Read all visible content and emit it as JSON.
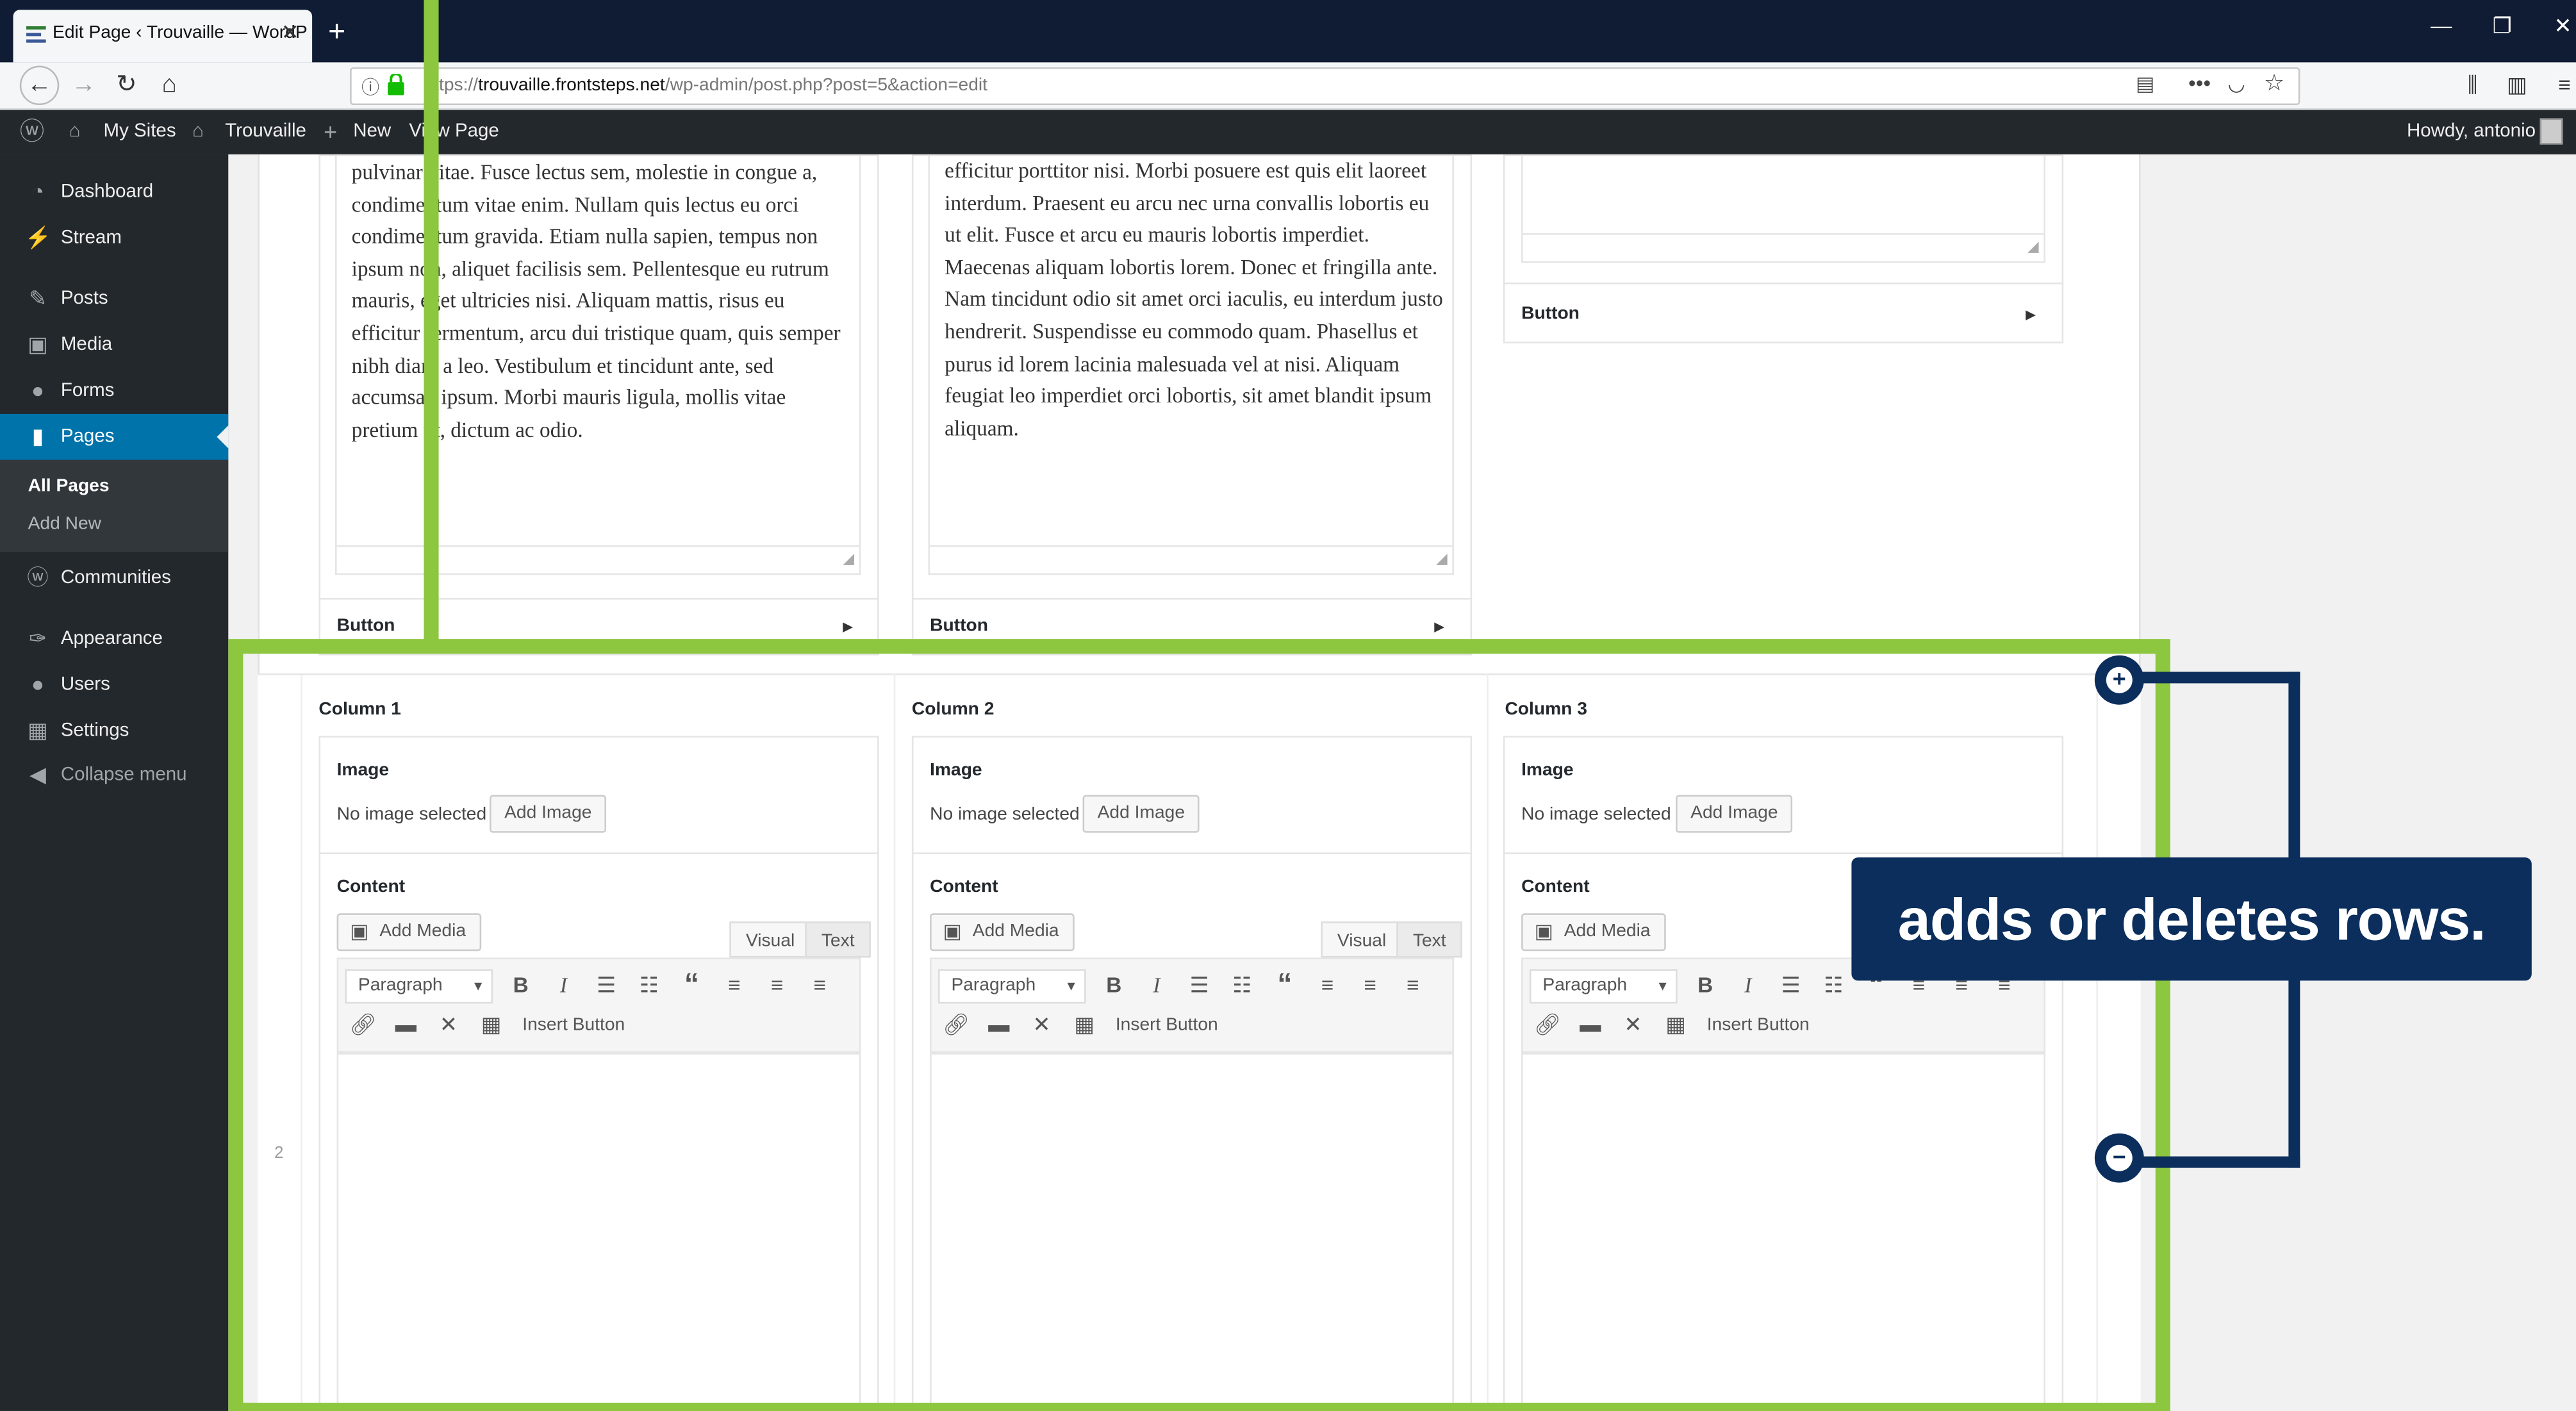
{
  "browser": {
    "tab_title": "Edit Page ‹ Trouvaille — WordP",
    "url_prefix": "https://",
    "url_domain": "trouvaille.frontsteps.net",
    "url_path": "/wp-admin/post.php?post=5&action=edit"
  },
  "adminbar": {
    "my_sites": "My Sites",
    "site_name": "Trouvaille",
    "new": "New",
    "view_page": "View Page",
    "howdy": "Howdy, antonio"
  },
  "sidebar": {
    "items": [
      {
        "label": "Dashboard",
        "icon": "dashboard-icon"
      },
      {
        "label": "Stream",
        "icon": "stream-icon"
      },
      {
        "label": "Posts",
        "icon": "pin-icon"
      },
      {
        "label": "Media",
        "icon": "media-icon"
      },
      {
        "label": "Forms",
        "icon": "forms-icon"
      },
      {
        "label": "Pages",
        "icon": "pages-icon"
      },
      {
        "label": "Communities",
        "icon": "communities-icon"
      },
      {
        "label": "Appearance",
        "icon": "brush-icon"
      },
      {
        "label": "Users",
        "icon": "user-icon"
      },
      {
        "label": "Settings",
        "icon": "settings-icon"
      },
      {
        "label": "Collapse menu",
        "icon": "collapse-icon"
      }
    ],
    "submenu": [
      "All Pages",
      "Add New"
    ]
  },
  "row1": {
    "col1_text": "pulvinar vitae. Fusce lectus sem, molestie in congue a, condimentum vitae enim. Nullam quis lectus eu orci condimentum gravida. Etiam nulla sapien, tempus non ipsum non, aliquet facilisis sem. Pellentesque eu rutrum mauris, eget ultricies nisi. Aliquam mattis, risus eu efficitur fermentum, arcu dui tristique quam, quis semper nibh diam a leo. Vestibulum et tincidunt ante, sed accumsan ipsum. Morbi mauris ligula, mollis vitae pretium ut, dictum ac odio.",
    "col2_text": "efficitur porttitor nisi. Morbi posuere est quis elit laoreet interdum. Praesent eu arcu nec urna convallis lobortis eu ut elit. Fusce et arcu eu mauris lobortis imperdiet. Maecenas aliquam lobortis lorem. Donec et fringilla ante. Nam tincidunt odio sit amet orci iaculis, eu interdum justo hendrerit. Suspendisse eu commodo quam. Phasellus et purus id lorem lacinia malesuada vel at nisi. Aliquam feugiat leo imperdiet orci lobortis, sit amet blandit ipsum aliquam.",
    "button_label": "Button"
  },
  "row2": {
    "row_number": "2",
    "columns": [
      {
        "title": "Column 1"
      },
      {
        "title": "Column 2"
      },
      {
        "title": "Column 3"
      }
    ],
    "image_label": "Image",
    "no_image": "No image selected",
    "add_image": "Add Image",
    "content_label": "Content",
    "add_media": "Add Media",
    "visual_tab": "Visual",
    "text_tab": "Text",
    "format_select": "Paragraph",
    "insert_button": "Insert Button"
  },
  "callout": {
    "text": "adds or deletes rows."
  },
  "colors": {
    "highlight": "#8dc63f",
    "callout": "#0b2e5c",
    "admin_blue": "#0073aa"
  }
}
